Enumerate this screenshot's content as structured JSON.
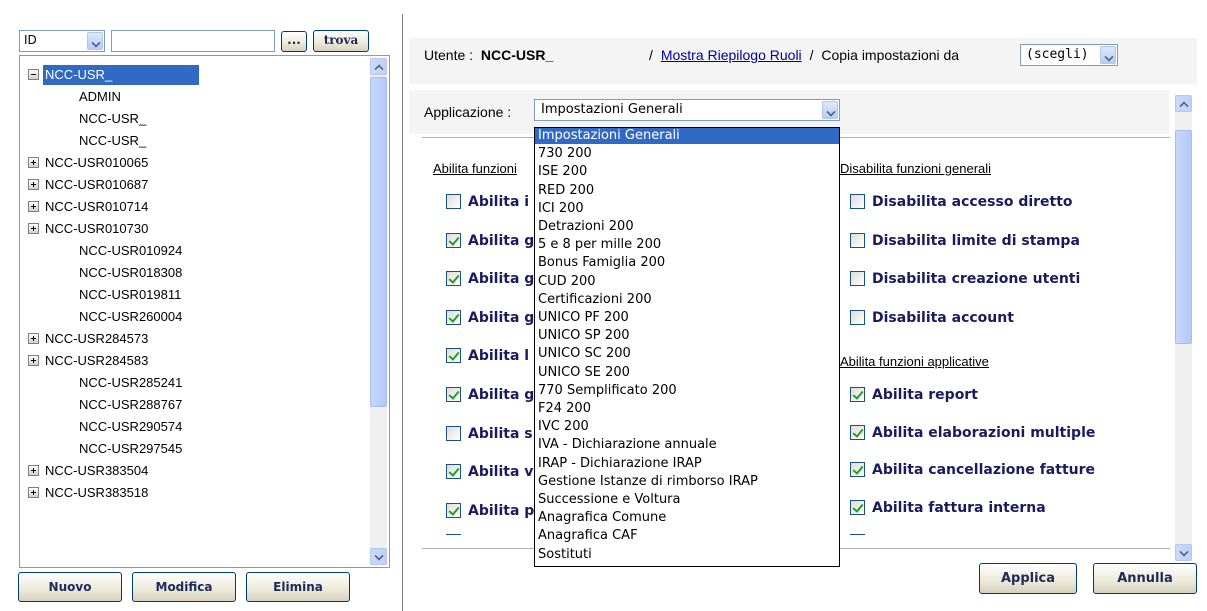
{
  "search": {
    "field_value": "ID",
    "query_value": "",
    "ellipsis_label": "...",
    "find_label": "trova"
  },
  "tree": {
    "root_label": "NCC-USR_",
    "items": [
      {
        "label": "ADMIN",
        "child": true,
        "expander": "none"
      },
      {
        "label": "NCC-USR_",
        "child": true,
        "expander": "none",
        "redacted": true
      },
      {
        "label": "NCC-USR_",
        "child": true,
        "expander": "none",
        "redacted": true
      },
      {
        "label": "NCC-USR010065",
        "child": false,
        "expander": "plus"
      },
      {
        "label": "NCC-USR010687",
        "child": false,
        "expander": "plus"
      },
      {
        "label": "NCC-USR010714",
        "child": false,
        "expander": "plus"
      },
      {
        "label": "NCC-USR010730",
        "child": false,
        "expander": "plus"
      },
      {
        "label": "NCC-USR010924",
        "child": true,
        "expander": "none"
      },
      {
        "label": "NCC-USR018308",
        "child": true,
        "expander": "none"
      },
      {
        "label": "NCC-USR019811",
        "child": true,
        "expander": "none"
      },
      {
        "label": "NCC-USR260004",
        "child": true,
        "expander": "none"
      },
      {
        "label": "NCC-USR284573",
        "child": false,
        "expander": "plus"
      },
      {
        "label": "NCC-USR284583",
        "child": false,
        "expander": "plus"
      },
      {
        "label": "NCC-USR285241",
        "child": true,
        "expander": "none"
      },
      {
        "label": "NCC-USR288767",
        "child": true,
        "expander": "none"
      },
      {
        "label": "NCC-USR290574",
        "child": true,
        "expander": "none"
      },
      {
        "label": "NCC-USR297545",
        "child": true,
        "expander": "none"
      },
      {
        "label": "NCC-USR383504",
        "child": false,
        "expander": "plus"
      },
      {
        "label": "NCC-USR383518",
        "child": false,
        "expander": "plus"
      }
    ]
  },
  "left_buttons": {
    "new_label": "Nuovo",
    "edit_label": "Modifica",
    "delete_label": "Elimina"
  },
  "header": {
    "user_prefix": "Utente :",
    "user_name": "NCC-USR_",
    "sep1": "/",
    "roles_link": "Mostra Riepilogo Ruoli",
    "sep2": "/",
    "copy_label": "Copia impostazioni da",
    "copy_select_value": "(scegli)"
  },
  "application": {
    "label": "Applicazione :",
    "selected": "Impostazioni Generali",
    "options": [
      "Impostazioni Generali",
      "730 200",
      "ISE 200",
      "RED 200",
      "ICI 200",
      "Detrazioni 200",
      "5 e 8 per mille 200",
      "Bonus Famiglia 200",
      "CUD 200",
      "Certificazioni 200",
      "UNICO PF 200",
      "UNICO SP 200",
      "UNICO SC 200",
      "UNICO SE 200",
      "770 Semplificato 200",
      "F24 200",
      "IVC 200",
      "IVA - Dichiarazione annuale",
      "IRAP - Dichiarazione IRAP",
      "Gestione Istanze di rimborso IRAP",
      "Successione e Voltura",
      "Anagrafica Comune",
      "Anagrafica CAF",
      "Sostituti"
    ]
  },
  "left_section": {
    "title": "Abilita funzioni",
    "items": [
      {
        "label": "Abilita i",
        "checked": false
      },
      {
        "label": "Abilita g",
        "checked": true
      },
      {
        "label": "Abilita g",
        "checked": true
      },
      {
        "label": "Abilita g",
        "checked": true
      },
      {
        "label": "Abilita l",
        "checked": true
      },
      {
        "label": "Abilita g",
        "checked": true
      },
      {
        "label": "Abilita s",
        "checked": false
      },
      {
        "label": "Abilita v",
        "checked": true
      },
      {
        "label": "Abilita p",
        "checked": true
      }
    ]
  },
  "disable_section": {
    "title": "Disabilita funzioni generali",
    "items": [
      {
        "label": "Disabilita accesso diretto",
        "checked": false
      },
      {
        "label": "Disabilita limite di stampa",
        "checked": false
      },
      {
        "label": "Disabilita creazione utenti",
        "checked": false
      },
      {
        "label": "Disabilita account",
        "checked": false
      }
    ]
  },
  "apps_section": {
    "title": "Abilita funzioni applicative",
    "items": [
      {
        "label": "Abilita report",
        "checked": true
      },
      {
        "label": "Abilita elaborazioni multiple",
        "checked": true
      },
      {
        "label": "Abilita cancellazione fatture",
        "checked": true
      },
      {
        "label": "Abilita fattura interna",
        "checked": true
      }
    ]
  },
  "right_buttons": {
    "apply_label": "Applica",
    "cancel_label": "Annulla"
  }
}
